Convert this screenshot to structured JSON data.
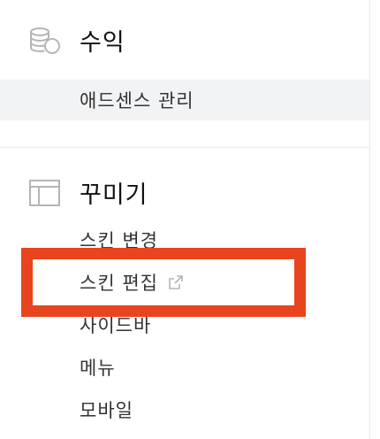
{
  "revenue": {
    "title": "수익",
    "icon": "coins-icon",
    "items": [
      {
        "label": "애드센스 관리",
        "active": true
      }
    ]
  },
  "decorate": {
    "title": "꾸미기",
    "icon": "layout-icon",
    "items": [
      {
        "label": "스킨 변경"
      },
      {
        "label": "스킨 편집",
        "external": true,
        "external_icon": "external-link-icon"
      },
      {
        "label": "사이드바"
      },
      {
        "label": "메뉴"
      },
      {
        "label": "모바일"
      }
    ]
  },
  "colors": {
    "highlight": "#e8451e",
    "active_bg": "#f2f3f4",
    "icon_gray": "#b5b5b5"
  }
}
